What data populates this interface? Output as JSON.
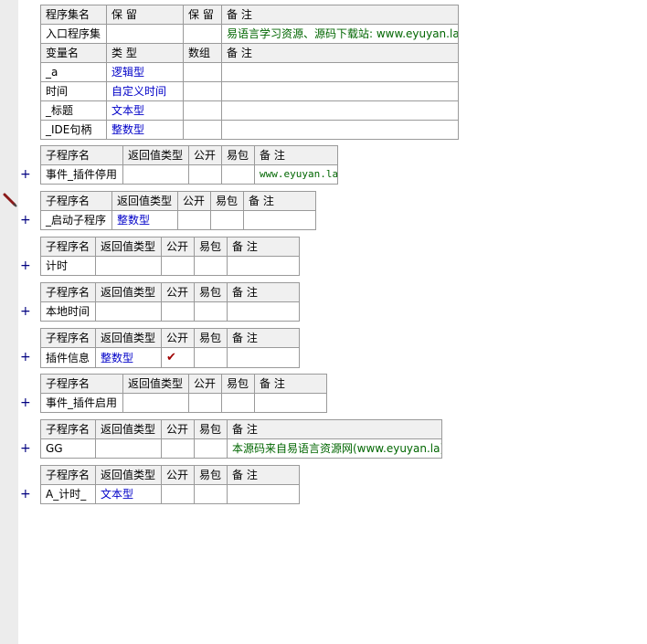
{
  "assembly_table": {
    "headers": [
      "程序集名",
      "保 留",
      "保 留",
      "备 注"
    ],
    "row": {
      "name": "入口程序集",
      "r1": "",
      "r2": "",
      "note": "易语言学习资源、源码下载站: www.eyuyan.la"
    }
  },
  "variables_table": {
    "headers": [
      "变量名",
      "类 型",
      "数组",
      "备 注"
    ],
    "rows": [
      {
        "name": "_a",
        "type": "逻辑型",
        "array": "",
        "note": ""
      },
      {
        "name": "时间",
        "type": "自定义时间",
        "array": "",
        "note": ""
      },
      {
        "name": "_标题",
        "type": "文本型",
        "array": "",
        "note": ""
      },
      {
        "name": "_IDE句柄",
        "type": "整数型",
        "array": "",
        "note": ""
      }
    ]
  },
  "sub_headers": [
    "子程序名",
    "返回值类型",
    "公开",
    "易包",
    "备 注"
  ],
  "subs": [
    {
      "name": "事件_插件停用",
      "ret": "",
      "public": "",
      "pkg": "",
      "note": "www.eyuyan.la"
    },
    {
      "name": "_启动子程序",
      "ret": "整数型",
      "public": "",
      "pkg": "",
      "note": ""
    },
    {
      "name": "计时",
      "ret": "",
      "public": "",
      "pkg": "",
      "note": ""
    },
    {
      "name": "本地时间",
      "ret": "",
      "public": "",
      "pkg": "",
      "note": ""
    },
    {
      "name": "插件信息",
      "ret": "整数型",
      "public": "✔",
      "pkg": "",
      "note": ""
    },
    {
      "name": "事件_插件启用",
      "ret": "",
      "public": "",
      "pkg": "",
      "note": ""
    },
    {
      "name": "GG",
      "ret": "",
      "public": "",
      "pkg": "",
      "note": "本源码来自易语言资源网(www.eyuyan.la)"
    },
    {
      "name": "A_计时_",
      "ret": "文本型",
      "public": "",
      "pkg": "",
      "note": ""
    }
  ],
  "expand_symbol": "+",
  "icons": {
    "expand": "plus-icon",
    "edit": "pencil-icon",
    "check": "checkmark-icon"
  }
}
